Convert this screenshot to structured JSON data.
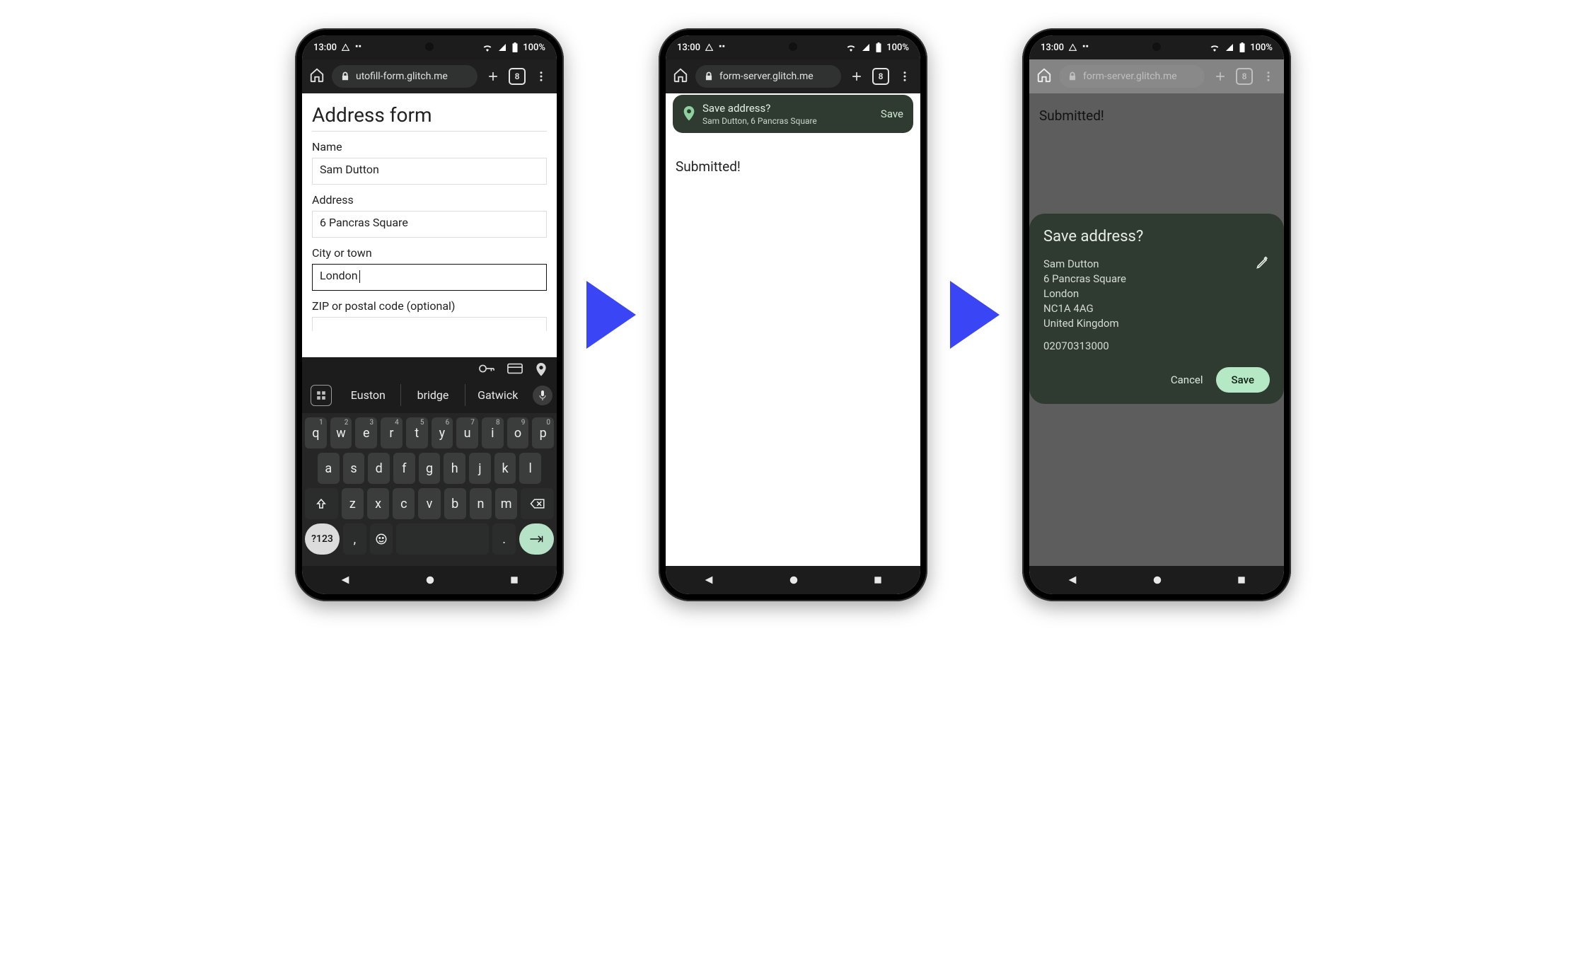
{
  "status": {
    "time": "13:00",
    "battery": "100%"
  },
  "tabs_count": "8",
  "phone1": {
    "url": "utofill-form.glitch.me",
    "form_title": "Address form",
    "fields": {
      "name_label": "Name",
      "name_value": "Sam Dutton",
      "address_label": "Address",
      "address_value": "6 Pancras Square",
      "city_label": "City or town",
      "city_value": "London",
      "zip_label": "ZIP or postal code (optional)",
      "zip_value": ""
    },
    "suggestions": [
      "Euston",
      "bridge",
      "Gatwick"
    ],
    "keyboard": {
      "row1": [
        [
          "q",
          "1"
        ],
        [
          "w",
          "2"
        ],
        [
          "e",
          "3"
        ],
        [
          "r",
          "4"
        ],
        [
          "t",
          "5"
        ],
        [
          "y",
          "6"
        ],
        [
          "u",
          "7"
        ],
        [
          "i",
          "8"
        ],
        [
          "o",
          "9"
        ],
        [
          "p",
          "0"
        ]
      ],
      "row2": [
        "a",
        "s",
        "d",
        "f",
        "g",
        "h",
        "j",
        "k",
        "l"
      ],
      "row3": [
        "z",
        "x",
        "c",
        "v",
        "b",
        "n",
        "m"
      ],
      "sym": "?123"
    }
  },
  "phone2": {
    "url": "form-server.glitch.me",
    "page_text": "Submitted!",
    "banner": {
      "title": "Save address?",
      "subtitle": "Sam Dutton, 6 Pancras Square",
      "action": "Save"
    }
  },
  "phone3": {
    "url": "form-server.glitch.me",
    "page_text": "Submitted!",
    "dialog": {
      "title": "Save address?",
      "lines": [
        "Sam Dutton",
        "6 Pancras Square",
        "London",
        "NC1A 4AG",
        "United Kingdom"
      ],
      "phone": "02070313000",
      "cancel": "Cancel",
      "save": "Save"
    }
  }
}
